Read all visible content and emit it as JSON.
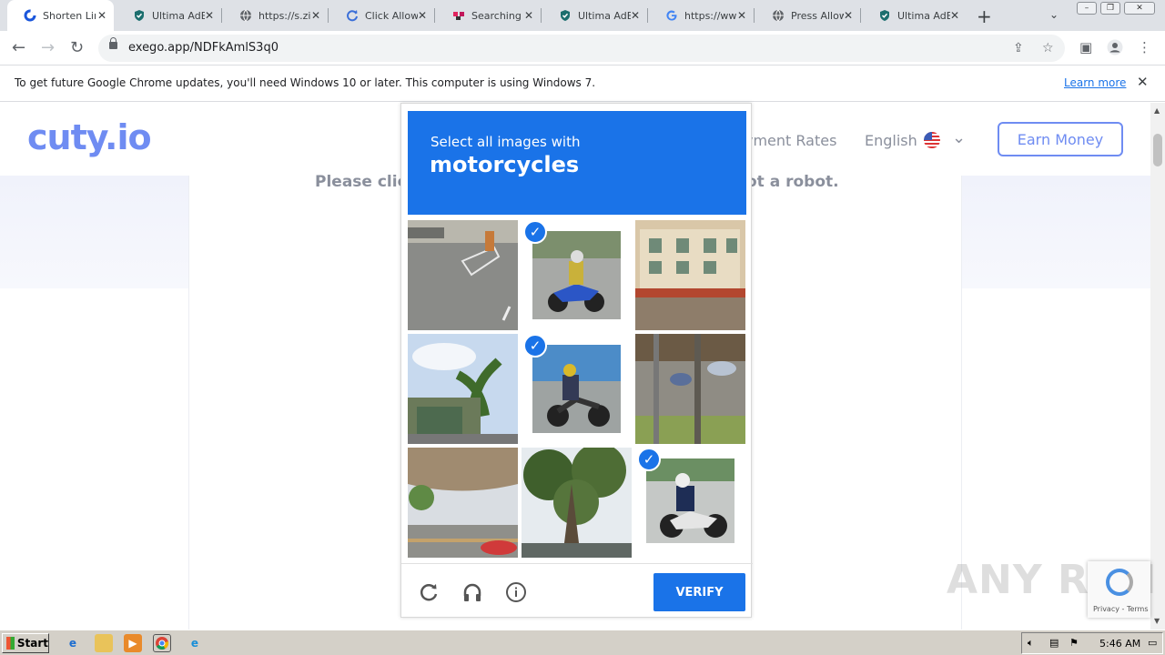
{
  "tabs": [
    {
      "title": "Shorten Lin",
      "icon": "cuty-icon",
      "active": true
    },
    {
      "title": "Ultima AdBl",
      "icon": "shield-icon"
    },
    {
      "title": "https://s.zi",
      "icon": "globe-icon"
    },
    {
      "title": "Click Allow",
      "icon": "refresh-icon"
    },
    {
      "title": "Searching f",
      "icon": "red-app-icon"
    },
    {
      "title": "Ultima AdBl",
      "icon": "shield-icon"
    },
    {
      "title": "https://ww",
      "icon": "google-icon"
    },
    {
      "title": "Press Allow",
      "icon": "globe-icon"
    },
    {
      "title": "Ultima AdBl",
      "icon": "shield-icon"
    }
  ],
  "omnibox": {
    "url": "exego.app/NDFkAmlS3q0"
  },
  "infobar": {
    "message": "To get future Google Chrome updates, you'll need Windows 10 or later. This computer is using Windows 7.",
    "link": "Learn more"
  },
  "site": {
    "logo": "cuty.io",
    "nav_partial": "yment Rates",
    "language": "English",
    "earn_button": "Earn Money",
    "prompt_left": "Please clic",
    "prompt_right": "ot a robot."
  },
  "captcha": {
    "instruction": "Select all images with",
    "target": "motorcycles",
    "tiles": [
      {
        "scene": "road-corner",
        "selected": false
      },
      {
        "scene": "motorcycle-rider-blue",
        "selected": true
      },
      {
        "scene": "shop-building",
        "selected": false
      },
      {
        "scene": "palm-trees-house",
        "selected": false
      },
      {
        "scene": "motorcycle-rider-yellow",
        "selected": true
      },
      {
        "scene": "street-cars",
        "selected": false
      },
      {
        "scene": "overpass-road",
        "selected": false
      },
      {
        "scene": "tree-canopy",
        "selected": false
      },
      {
        "scene": "motorcycle-rider-white",
        "selected": true
      }
    ],
    "verify_label": "VERIFY"
  },
  "watermark": "ANY RUN",
  "recaptcha_badge": "Privacy - Terms",
  "taskbar": {
    "start": "Start",
    "clock": "5:46 AM"
  },
  "colors": {
    "accent": "#1a73e8",
    "brand": "#6f8cf2"
  }
}
